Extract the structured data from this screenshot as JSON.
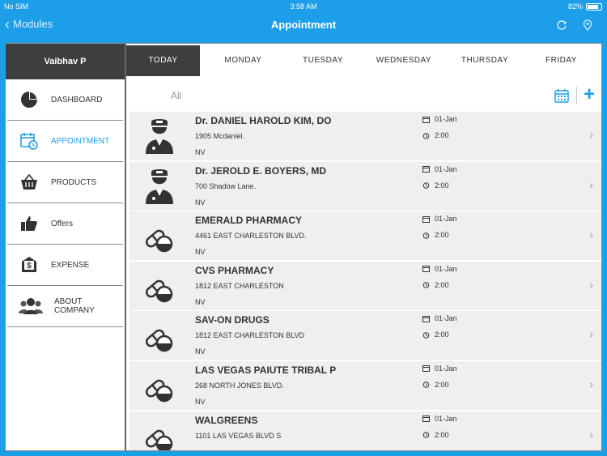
{
  "status_bar": {
    "carrier": "No SIM",
    "time": "3:58 AM",
    "battery": "82%"
  },
  "nav": {
    "back_label": "Modules",
    "title": "Appointment",
    "refresh_icon": "refresh-icon",
    "info_icon": "map-pin-icon"
  },
  "colors": {
    "accent": "#1d9ee9",
    "dark": "#3e3e3e",
    "row_bg": "#efefef"
  },
  "sidebar": {
    "user": "Vaibhav P",
    "items": [
      {
        "label": "DASHBOARD",
        "icon": "pie-chart-icon"
      },
      {
        "label": "APPOINTMENT",
        "icon": "calendar-clock-icon",
        "active": true
      },
      {
        "label": "PRODUCTS",
        "icon": "basket-icon"
      },
      {
        "label": "Offers",
        "icon": "thumbs-up-icon"
      },
      {
        "label": "EXPENSE",
        "icon": "money-envelope-icon"
      },
      {
        "label": "ABOUT COMPANY",
        "icon": "people-icon"
      }
    ]
  },
  "tabs": [
    "TODAY",
    "MONDAY",
    "TUESDAY",
    "WEDNESDAY",
    "THURSDAY",
    "FRIDAY"
  ],
  "filter": {
    "all_label": "All"
  },
  "appointments": [
    {
      "name": "Dr. DANIEL HAROLD KIM, DO",
      "address": "1905 Mcdaniel.",
      "state": "NV",
      "date": "01-Jan",
      "time": "2:00",
      "type": "doctor"
    },
    {
      "name": "Dr. JEROLD E. BOYERS, MD",
      "address": "700 Shadow Lane.",
      "state": "NV",
      "date": "01-Jan",
      "time": "2:00",
      "type": "doctor"
    },
    {
      "name": "EMERALD PHARMACY",
      "address": "4461 EAST CHARLESTON BLVD.",
      "state": "NV",
      "date": "01-Jan",
      "time": "2:00",
      "type": "pharmacy"
    },
    {
      "name": "CVS PHARMACY",
      "address": "1812 EAST CHARLESTON",
      "state": "NV",
      "date": "01-Jan",
      "time": "2:00",
      "type": "pharmacy"
    },
    {
      "name": "SAV-ON DRUGS",
      "address": "1812 EAST CHARLESTON BLVD",
      "state": "NV",
      "date": "01-Jan",
      "time": "2:00",
      "type": "pharmacy"
    },
    {
      "name": "LAS VEGAS PAIUTE TRIBAL P",
      "address": "268 NORTH JONES BLVD.",
      "state": "NV",
      "date": "01-Jan",
      "time": "2:00",
      "type": "pharmacy"
    },
    {
      "name": "WALGREENS",
      "address": "1101 LAS VEGAS BLVD S",
      "state": "",
      "date": "01-Jan",
      "time": "2:00",
      "type": "pharmacy"
    }
  ]
}
